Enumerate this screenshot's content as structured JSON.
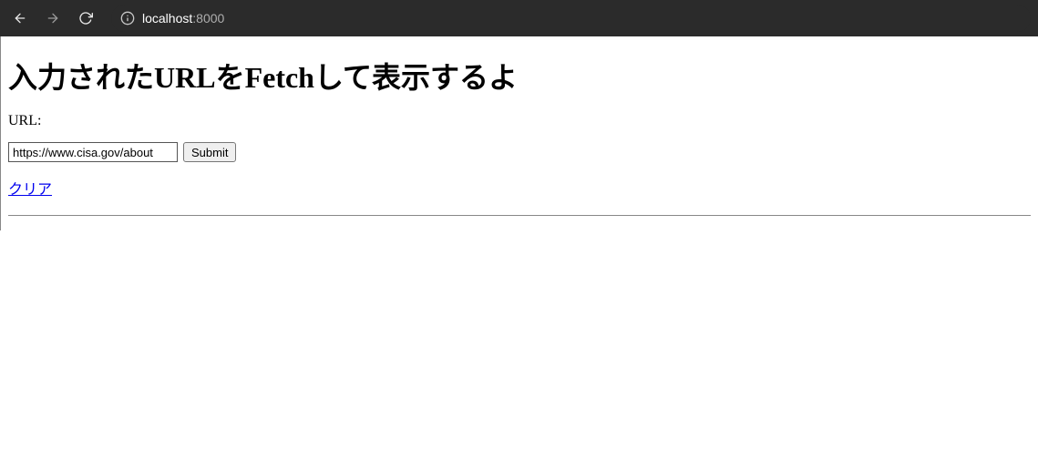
{
  "browser": {
    "address_host": "localhost",
    "address_port": ":8000"
  },
  "page": {
    "heading": "入力されたURLをFetchして表示するよ",
    "url_label": "URL:",
    "url_input_value": "https://www.cisa.gov/about",
    "submit_label": "Submit",
    "clear_link_label": "クリア"
  }
}
